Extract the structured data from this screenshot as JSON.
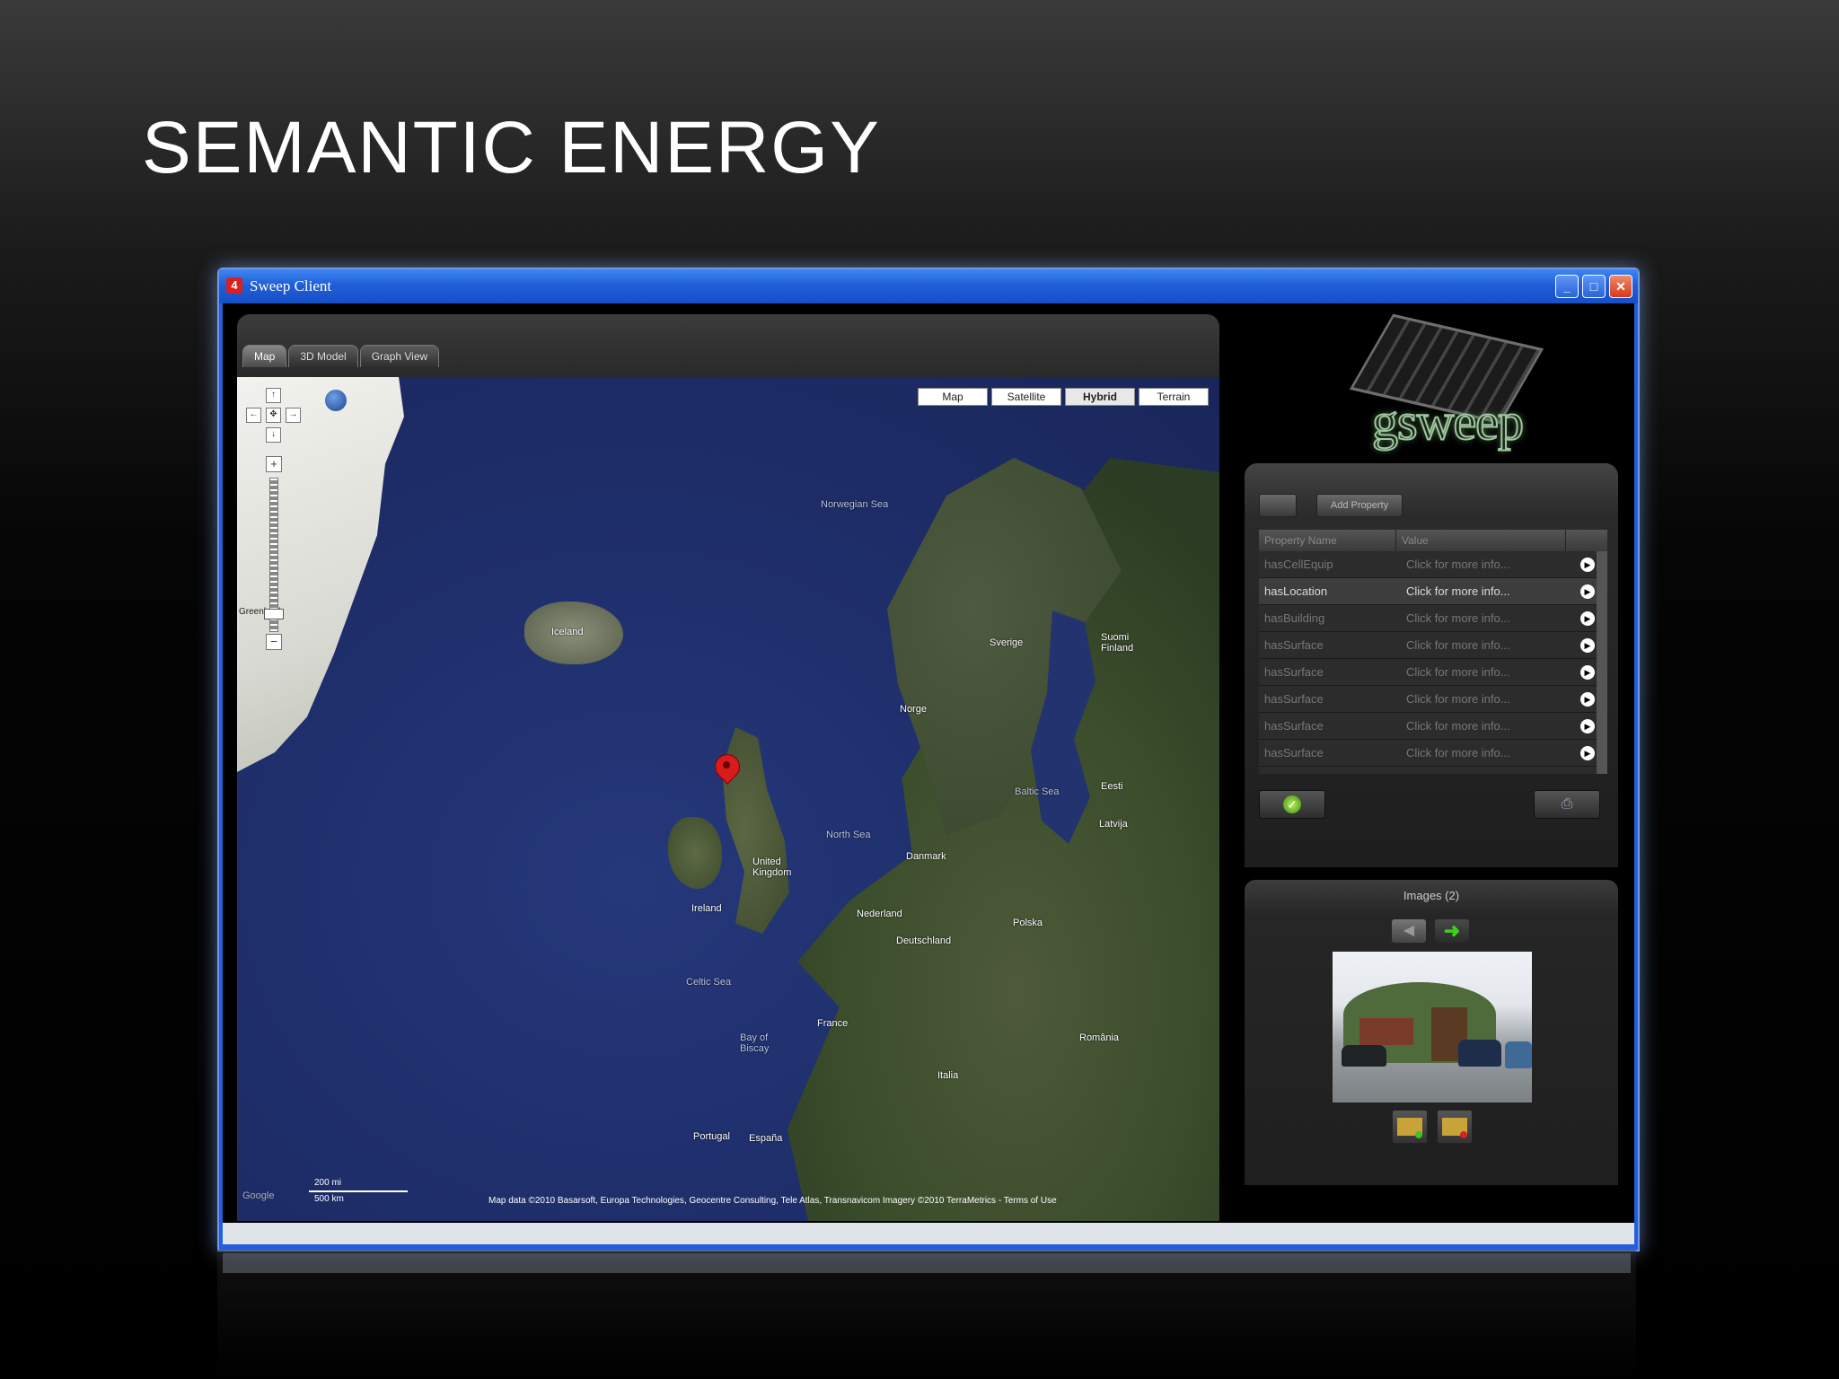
{
  "slide": {
    "title": "SEMANTIC ENERGY"
  },
  "window": {
    "title": "Sweep Client",
    "icon_label": "4",
    "buttons": {
      "minimize": "_",
      "maximize": "□",
      "close": "✕"
    }
  },
  "tabs": [
    {
      "label": "Map",
      "active": true
    },
    {
      "label": "3D Model",
      "active": false
    },
    {
      "label": "Graph View",
      "active": false
    }
  ],
  "map": {
    "types": [
      {
        "label": "Map",
        "active": false
      },
      {
        "label": "Satellite",
        "active": false
      },
      {
        "label": "Hybrid",
        "active": true
      },
      {
        "label": "Terrain",
        "active": false
      }
    ],
    "labels": {
      "norwegian_sea": "Norwegian Sea",
      "iceland": "Iceland",
      "greenland": "Greenland",
      "sverige": "Sverige",
      "suomi": "Suomi Finland",
      "norge": "Norge",
      "north_sea": "North Sea",
      "uk": "United Kingdom",
      "ireland": "Ireland",
      "danmark": "Danmark",
      "nederland": "Nederland",
      "deutschland": "Deutschland",
      "polska": "Polska",
      "france": "France",
      "espana": "España",
      "portugal": "Portugal",
      "italia": "Italia",
      "romania": "România",
      "latvija": "Latvija",
      "eesti": "Eesti",
      "celtic_sea": "Celtic Sea",
      "bay_of_biscay": "Bay of Biscay",
      "baltic_sea": "Baltic Sea"
    },
    "scale": {
      "miles": "200 mi",
      "km": "500 km"
    },
    "attribution": "Map data ©2010 Basarsoft, Europa Technologies, Geocentre Consulting, Tele Atlas, Transnavicom Imagery ©2010 TerraMetrics - Terms of Use",
    "logo": "Google"
  },
  "brand": {
    "logo_text": "gsweep"
  },
  "properties": {
    "top_buttons": [
      "",
      "Add Property"
    ],
    "columns": [
      "Property Name",
      "Value"
    ],
    "rows": [
      {
        "name": "hasCellEquip",
        "value": "Click for more info...",
        "selected": false
      },
      {
        "name": "hasLocation",
        "value": "Click for more info...",
        "selected": true
      },
      {
        "name": "hasBuilding",
        "value": "Click for more info...",
        "selected": false
      },
      {
        "name": "hasSurface",
        "value": "Click for more info...",
        "selected": false
      },
      {
        "name": "hasSurface",
        "value": "Click for more info...",
        "selected": false
      },
      {
        "name": "hasSurface",
        "value": "Click for more info...",
        "selected": false
      },
      {
        "name": "hasSurface",
        "value": "Click for more info...",
        "selected": false
      },
      {
        "name": "hasSurface",
        "value": "Click for more info...",
        "selected": false
      }
    ]
  },
  "images": {
    "title": "Images (2)"
  }
}
